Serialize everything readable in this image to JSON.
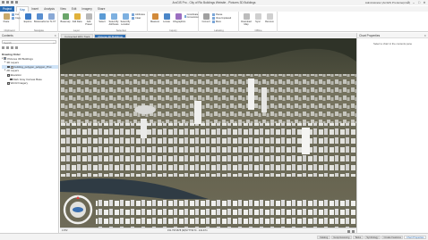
{
  "window": {
    "title": "ArcGIS Pro - City of Rio Buildings Website - Pictures 3D Buildings",
    "user": "Administrator (ArcGIS Pro Enterprise)",
    "controls": [
      "?",
      "–",
      "□",
      "✕"
    ]
  },
  "ribbon_tabs": [
    "Project",
    "Map",
    "Insert",
    "Analysis",
    "View",
    "Edit",
    "Imagery",
    "Share"
  ],
  "ribbon": {
    "groups": [
      {
        "label": "Clipboard",
        "buttons": [
          "Paste"
        ],
        "small": [
          "Cut",
          "Copy",
          "Copy Path"
        ]
      },
      {
        "label": "Navigate",
        "buttons": [
          "Explore",
          "Bookmarks",
          "Go To XY"
        ],
        "small": []
      },
      {
        "label": "Layer",
        "buttons": [
          "Basemap",
          "Add Data",
          "Add Preset"
        ],
        "small": []
      },
      {
        "label": "Selection",
        "buttons": [
          "Select",
          "Select By Attributes",
          "Select By Location"
        ],
        "small": [
          "Attributes",
          "Clear"
        ]
      },
      {
        "label": "Inquiry",
        "buttons": [
          "Measure",
          "Locate",
          "Infographics"
        ],
        "small": [
          "Coordinate Conversion"
        ]
      },
      {
        "label": "Labeling",
        "buttons": [
          "Convert"
        ],
        "small": [
          "Pause",
          "View Unplaced",
          "More"
        ]
      },
      {
        "label": "Offline",
        "buttons": [
          "Download Map",
          "Sync",
          "Remove"
        ],
        "small": []
      }
    ]
  },
  "contents": {
    "title": "Contents",
    "search_placeholder": "Search",
    "drawing_order_label": "Drawing Order",
    "tree": [
      {
        "label": "Pictures 3D Buildings",
        "level": 0,
        "checked": true
      },
      {
        "label": "3D Layers",
        "level": 1,
        "checked": false
      },
      {
        "label": "building_polygon_polygon_Prot",
        "level": 2,
        "checked": true
      },
      {
        "label": "2D Layers",
        "level": 1,
        "checked": false
      },
      {
        "label": "Elevation",
        "level": 2,
        "checked": true
      },
      {
        "label": "Dark Gray Canvas Base",
        "level": 3,
        "checked": false
      },
      {
        "label": "World Imagery",
        "level": 2,
        "checked": true
      }
    ]
  },
  "map": {
    "tabs": [
      "Connected With Track",
      "Pictures 3D Buildings"
    ],
    "active_tab_index": 1,
    "scale": "1:872",
    "coordinates": "151.7974678 (W)NY7T3174 · 141.47m",
    "scene_description": "3D city scene with white building extrusions"
  },
  "chart_properties": {
    "title": "Chart Properties",
    "message": "Select a chart in the contents pane"
  },
  "bottom_tabs": [
    "Catalog",
    "Geoprocessing",
    "Tasks",
    "Symbology",
    "Create Features",
    "Chart Properties"
  ],
  "colors": {
    "accent": "#2b6cb3",
    "ribbon_bg": "#ffffff",
    "chrome_bg": "#f3f3f3"
  }
}
